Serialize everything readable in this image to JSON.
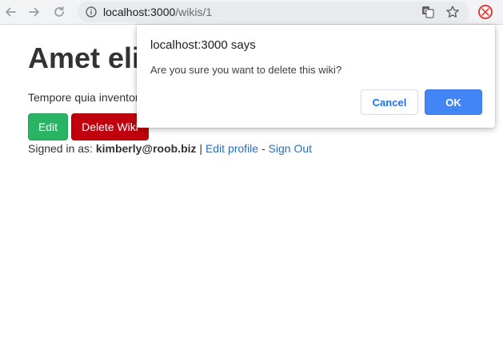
{
  "browser": {
    "url_host": "localhost:3000",
    "url_path": "/wikis/1"
  },
  "page": {
    "title": "Amet eli",
    "body_text": "Tempore quia inventor",
    "edit_label": "Edit",
    "delete_label": "Delete Wiki",
    "signed_in_prefix": "Signed in as: ",
    "user_email": "kimberly@roob.biz",
    "separator1": " | ",
    "edit_profile_label": "Edit profile",
    "separator2": " - ",
    "sign_out_label": "Sign Out"
  },
  "dialog": {
    "title": "localhost:3000 says",
    "message": "Are you sure you want to delete this wiki?",
    "cancel_label": "Cancel",
    "ok_label": "OK"
  },
  "colors": {
    "edit_button": "#28b463",
    "delete_button": "#c0000c",
    "link": "#2a6ebb",
    "ok_button": "#4285f4",
    "cancel_text": "#1a73e8"
  },
  "icons": {
    "back": "back-arrow-icon",
    "forward": "forward-arrow-icon",
    "reload": "reload-icon",
    "info": "info-icon",
    "translate": "translate-icon",
    "bookmark": "star-icon",
    "extension": "extension-icon"
  }
}
